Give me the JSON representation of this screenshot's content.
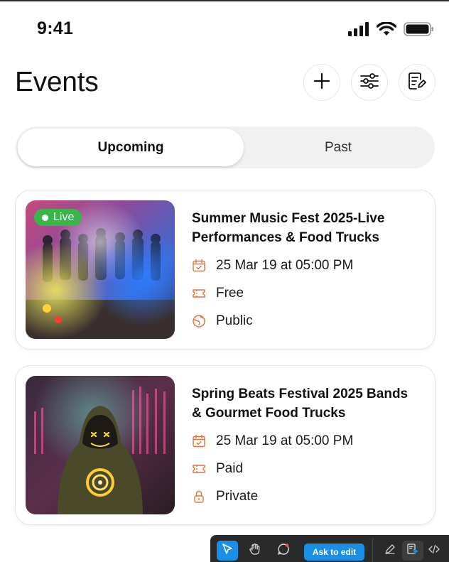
{
  "status_bar": {
    "time": "9:41"
  },
  "header": {
    "title": "Events"
  },
  "tabs": {
    "upcoming": "Upcoming",
    "past": "Past"
  },
  "events": [
    {
      "badge": "Live",
      "title": "Summer Music Fest 2025-Live Performances & Food Trucks",
      "date": "25 Mar 19 at 05:00 PM",
      "price": "Free",
      "visibility": "Public"
    },
    {
      "badge": "",
      "title": "Spring Beats Festival 2025 Bands & Gourmet Food Trucks",
      "date": "25 Mar 19 at 05:00 PM",
      "price": "Paid",
      "visibility": "Private"
    }
  ],
  "toolbar": {
    "ask_label": "Ask to edit"
  },
  "colors": {
    "accent": "#e0733a",
    "live": "#3bb54a",
    "toolbar_bg": "#2a2a2a",
    "ask_button": "#1a8fe6"
  },
  "icons": [
    "signal-icon",
    "wifi-icon",
    "battery-icon",
    "plus-icon",
    "filter-icon",
    "notes-icon",
    "calendar-icon",
    "ticket-icon",
    "globe-icon",
    "lock-icon",
    "pointer-icon",
    "hand-icon",
    "comment-icon",
    "edit-icon",
    "inspect-icon",
    "code-icon"
  ]
}
